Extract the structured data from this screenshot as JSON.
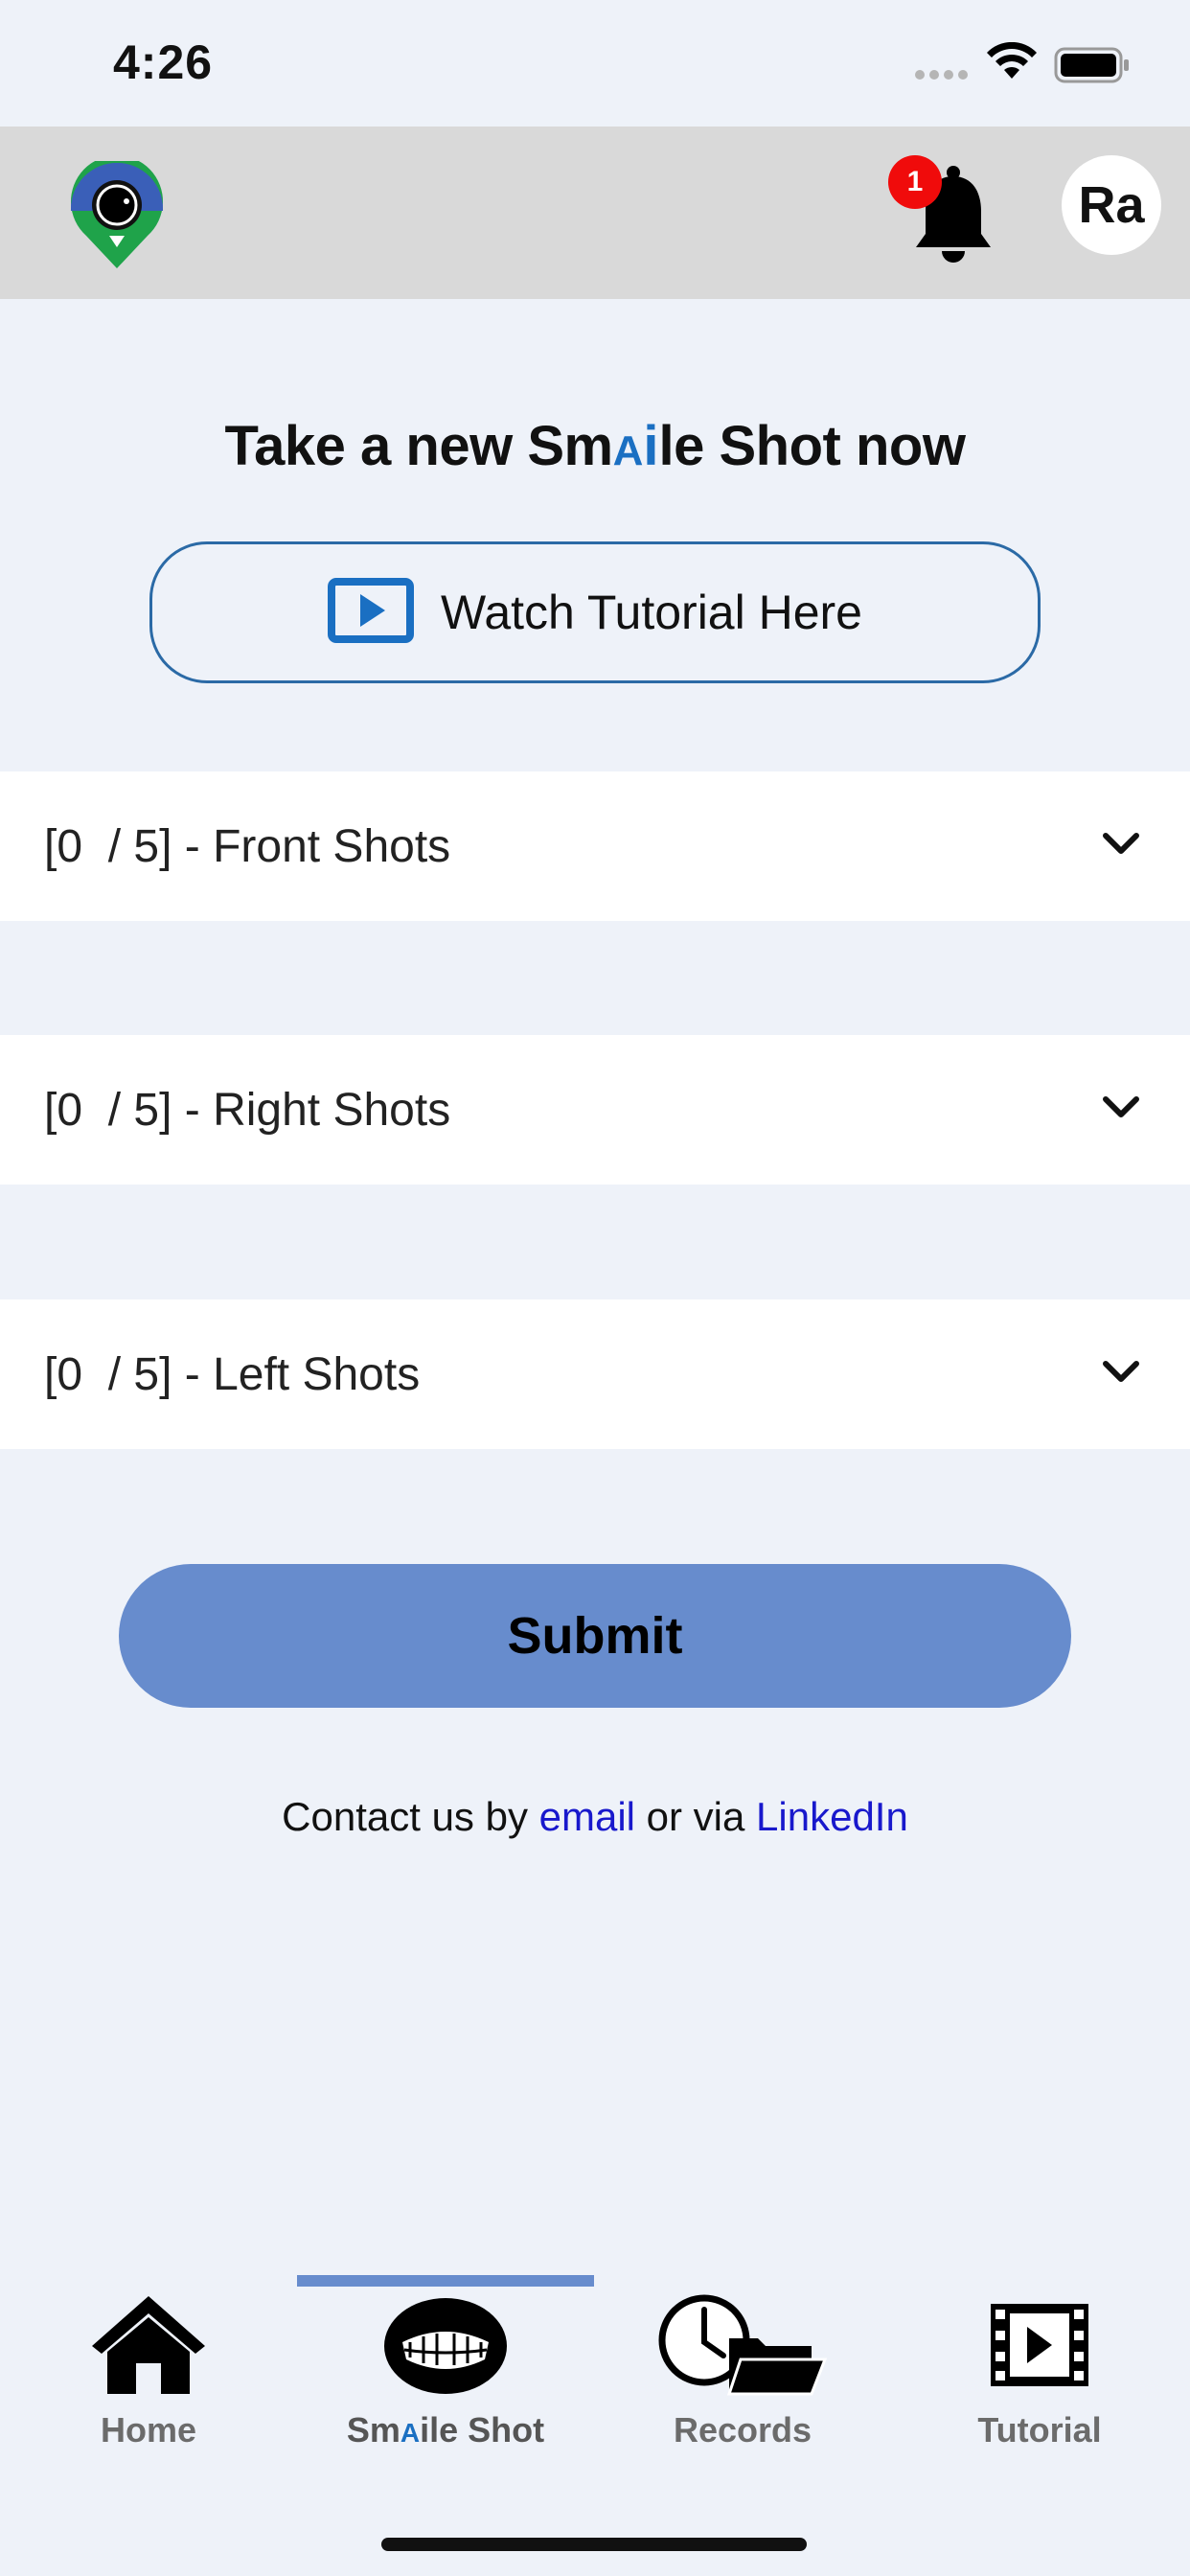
{
  "status_bar": {
    "time": "4:26"
  },
  "header": {
    "notification_count": "1",
    "avatar_initials": "Ra"
  },
  "main": {
    "title_prefix": "Take a new Sm",
    "title_ai": "A",
    "title_i": "i",
    "title_suffix": "le Shot now",
    "tutorial_label": "Watch Tutorial Here",
    "sections": [
      {
        "label": "[0  / 5] - Front Shots"
      },
      {
        "label": "[0  / 5] - Right Shots"
      },
      {
        "label": "[0  / 5] - Left Shots"
      }
    ],
    "submit_label": "Submit",
    "contact_prefix": "Contact us by ",
    "contact_email": "email",
    "contact_middle": " or via ",
    "contact_linkedin": "LinkedIn"
  },
  "tabs": [
    {
      "label": "Home",
      "icon": "home-icon"
    },
    {
      "label_prefix": "Sm",
      "label_ai": "A",
      "label_suffix": "ile Shot",
      "icon": "teeth-icon",
      "active": true
    },
    {
      "label": "Records",
      "icon": "records-icon"
    },
    {
      "label": "Tutorial",
      "icon": "film-icon"
    }
  ],
  "colors": {
    "background": "#eef2f9",
    "header": "#d9d9d9",
    "accent": "#678ccd",
    "ai_blue": "#1a6fc2",
    "badge_red": "#f00b0b",
    "link": "#1818cc"
  }
}
